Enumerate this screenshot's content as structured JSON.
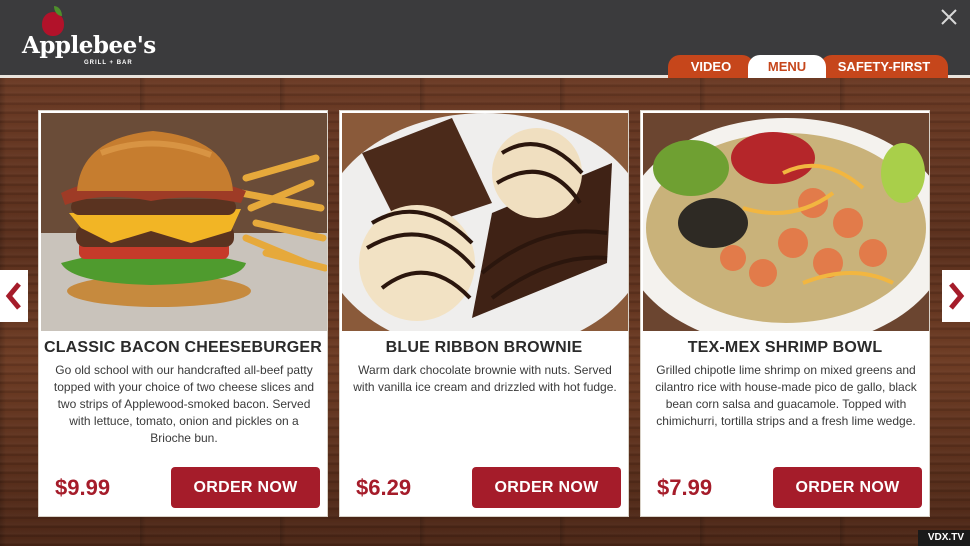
{
  "brand": {
    "name": "Applebee's",
    "tagline": "GRILL + BAR",
    "colors": {
      "accent": "#a51c2a",
      "tab": "#c6461b",
      "header": "#3b3b3d"
    }
  },
  "header": {
    "close_icon": "close-icon",
    "tabs": [
      {
        "label": "VIDEO",
        "active": false
      },
      {
        "label": "MENU",
        "active": true
      },
      {
        "label": "SAFETY-FIRST",
        "active": false
      }
    ]
  },
  "carousel": {
    "prev_icon": "chevron-left-icon",
    "next_icon": "chevron-right-icon"
  },
  "cards": [
    {
      "title": "CLASSIC BACON CHEESEBURGER",
      "description": "Go old school with our handcrafted all-beef patty topped with your choice of two cheese slices and two strips of Applewood-smoked bacon. Served with lettuce, tomato, onion and pickles on a Brioche bun.",
      "price": "$9.99",
      "button": "ORDER NOW",
      "image": "cheeseburger-photo"
    },
    {
      "title": "BLUE RIBBON BROWNIE",
      "description": "Warm dark chocolate brownie with nuts. Served with vanilla ice cream and drizzled with hot fudge.",
      "price": "$6.29",
      "button": "ORDER NOW",
      "image": "brownie-photo"
    },
    {
      "title": "TEX-MEX SHRIMP BOWL",
      "description": "Grilled chipotle lime shrimp on mixed greens and cilantro rice with house-made pico de gallo, black bean corn salsa and guacamole. Topped with chimichurri, tortilla strips and a fresh lime wedge.",
      "price": "$7.99",
      "button": "ORDER NOW",
      "image": "shrimp-bowl-photo"
    }
  ],
  "watermark": "VDX.TV"
}
